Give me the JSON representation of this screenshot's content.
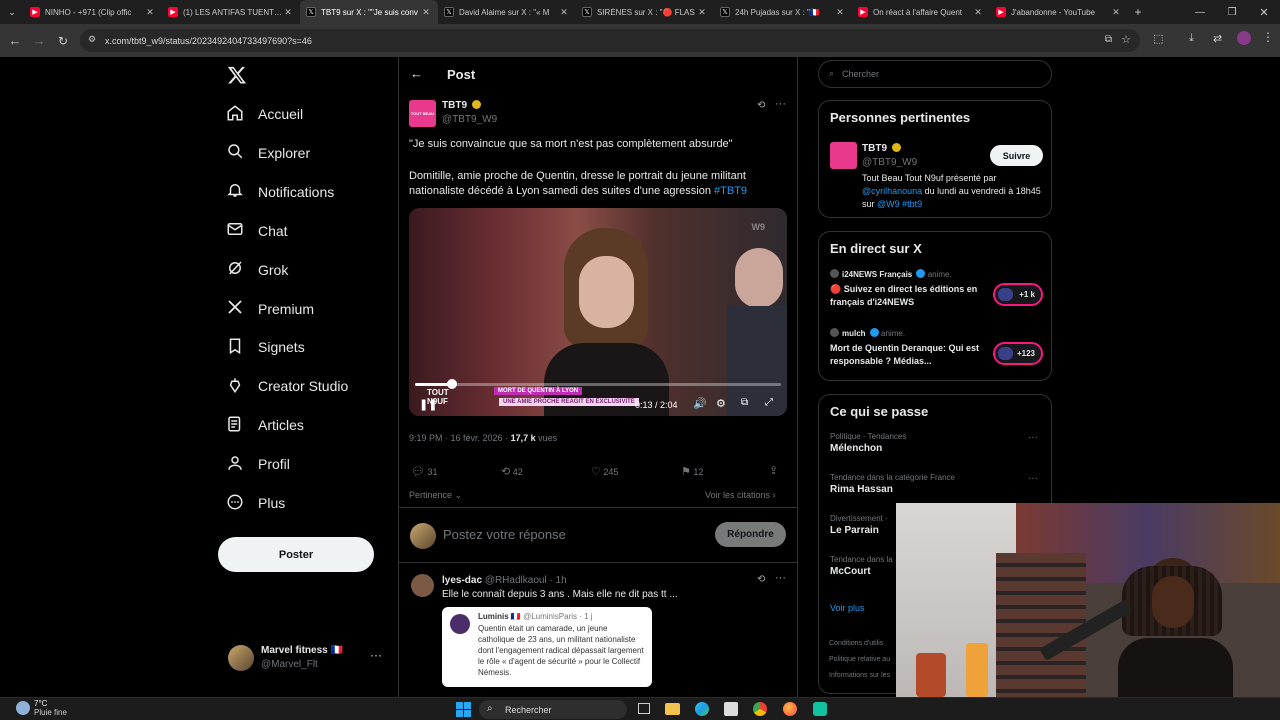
{
  "browser": {
    "tabs": [
      {
        "title": "NINHO - +971 (Clip offic",
        "icon": "youtube-icon",
        "active": false
      },
      {
        "title": "(1) LES ANTIFAS TUENT Q",
        "icon": "youtube-icon",
        "active": false
      },
      {
        "title": "TBT9 sur X : \"\"Je suis conv",
        "icon": "x-icon",
        "active": true
      },
      {
        "title": "David Alaime sur X : \"« M",
        "icon": "x-icon",
        "active": false
      },
      {
        "title": "SIRÈNES sur X : \"🔴 FLAS",
        "icon": "x-icon",
        "active": false
      },
      {
        "title": "24h Pujadas sur X : \"🇫🇷 ",
        "icon": "x-icon",
        "active": false
      },
      {
        "title": "On réact à l'affaire Quent",
        "icon": "youtube-icon",
        "active": false
      },
      {
        "title": "J'abandonne - YouTube",
        "icon": "youtube-icon",
        "active": false
      }
    ],
    "url": "x.com/tbt9_w9/status/2023492404733497690?s=46"
  },
  "nav": {
    "items": [
      {
        "label": "Accueil",
        "icon": "home-icon"
      },
      {
        "label": "Explorer",
        "icon": "search-icon"
      },
      {
        "label": "Notifications",
        "icon": "bell-icon"
      },
      {
        "label": "Chat",
        "icon": "mail-icon"
      },
      {
        "label": "Grok",
        "icon": "grok-icon"
      },
      {
        "label": "Premium",
        "icon": "x-logo-icon"
      },
      {
        "label": "Signets",
        "icon": "bookmark-icon"
      },
      {
        "label": "Creator Studio",
        "icon": "creator-icon"
      },
      {
        "label": "Articles",
        "icon": "articles-icon"
      },
      {
        "label": "Profil",
        "icon": "person-icon"
      },
      {
        "label": "Plus",
        "icon": "more-circle-icon"
      }
    ],
    "post_button": "Poster",
    "account": {
      "name": "Marvel fitness 🇫🇷",
      "handle": "@Marvel_Flt"
    }
  },
  "main": {
    "header_title": "Post",
    "post": {
      "author": "TBT9",
      "handle": "@TBT9_W9",
      "avatar_text": "TOUT BEAU",
      "quote": "\"Je suis convaincue que sa mort n'est pas complètement absurde\"",
      "body": "Domitille, amie proche de Quentin, dresse le portrait du jeune militant nationaliste décédé à Lyon samedi des suites d'une agression ",
      "hashtag": "#TBT9",
      "video": {
        "banner_top": "MORT DE QUENTIN À LYON",
        "banner_bottom": "UNE AMIE PROCHE RÉAGIT EN EXCLUSIVITÉ",
        "logo": "TOUT N9UF",
        "time": "0:13 / 2:04",
        "progress": 0.1
      },
      "timestamp": "9:19 PM · 16 févr. 2026 · ",
      "views_count": "17,7 k",
      "views_label": " vues",
      "stats": {
        "replies": "31",
        "reposts": "42",
        "likes": "245",
        "bookmarks": "12"
      },
      "relevance": "Pertinence",
      "quotes_link": "Voir les citations"
    },
    "reply_placeholder": "Postez votre réponse",
    "reply_button": "Répondre",
    "reply": {
      "author": "lyes-dac",
      "handle": "@RHadlkaoul",
      "time": "· 1h",
      "text": "Elle le connaît depuis 3 ans . Mais elle ne dit pas tt ...",
      "quoted": {
        "author": "Luminis 🇫🇷",
        "handle": "@LuminisParis · 1 j",
        "text": "Quentin était un camarade, un jeune catholique de 23 ans, un militant nationaliste dont l'engagement radical dépassait largement le rôle « d'agent de sécurité » pour le Collectif Némesis."
      }
    }
  },
  "right": {
    "search_placeholder": "Chercher",
    "relevant": {
      "title": "Personnes pertinentes",
      "name": "TBT9",
      "handle": "@TBT9_W9",
      "follow": "Suivre",
      "bio_1": "Tout Beau Tout N9uf présenté par ",
      "bio_mention": "@cyrilhanouna",
      "bio_2": " du lundi au vendredi à 18h45 sur ",
      "bio_mention2": "@W9",
      "bio_tag": " #tbt9"
    },
    "live": {
      "title": "En direct sur X",
      "items": [
        {
          "source": "i24NEWS Français",
          "suffix": "anime.",
          "text": "🔴 Suivez en direct les éditions en français d'i24NEWS",
          "badge": "+1 k"
        },
        {
          "source": "mulch",
          "suffix": "anime.",
          "text": "Mort de Quentin Deranque: Qui est responsable ? Médias...",
          "badge": "+123"
        }
      ]
    },
    "happening": {
      "title": "Ce qui se passe",
      "items": [
        {
          "context": "Politique · Tendances",
          "topic": "Mélenchon"
        },
        {
          "context": "Tendance dans la catégorie France",
          "topic": "Rima Hassan"
        },
        {
          "context": "Divertissement · ",
          "topic": "Le Parrain"
        },
        {
          "context": "Tendance dans la",
          "topic": "McCourt"
        }
      ],
      "more": "Voir plus"
    },
    "footer": [
      "Conditions d'utilis",
      "Politique relative au",
      "Informations sur les"
    ]
  },
  "taskbar": {
    "weather_temp": "7°C",
    "weather_desc": "Pluie fine",
    "search": "Rechercher"
  },
  "colors": {
    "accent": "#1d9bf0",
    "verified_gold": "#e2b719",
    "live_pink": "#f91880"
  }
}
